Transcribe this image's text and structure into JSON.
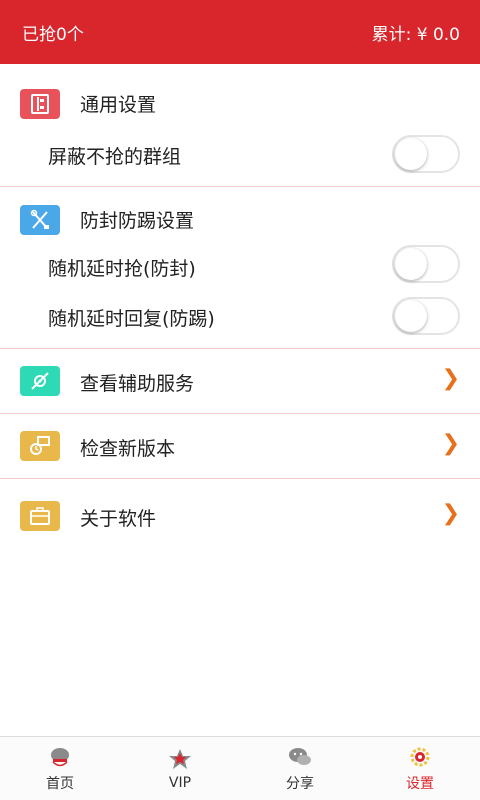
{
  "header": {
    "grabbed": "已抢0个",
    "total": "累计: ¥ 0.0"
  },
  "sections": {
    "general": {
      "title": "通用设置",
      "icon": "sliders-icon",
      "color": "#e8525a"
    },
    "block_groups": {
      "label": "屏蔽不抢的群组",
      "on": false
    },
    "anti": {
      "title": "防封防踢设置",
      "icon": "tools-icon",
      "color": "#4aa8e8"
    },
    "random_delay_grab": {
      "label": "随机延时抢(防封)",
      "on": false
    },
    "random_delay_reply": {
      "label": "随机延时回复(防踢)",
      "on": false
    },
    "accessibility": {
      "title": "查看辅助服务",
      "icon": "service-icon",
      "color": "#2ed9b5"
    },
    "update": {
      "title": "检查新版本",
      "icon": "update-icon",
      "color": "#e8b84a"
    },
    "about": {
      "title": "关于软件",
      "icon": "briefcase-icon",
      "color": "#e8b84a"
    }
  },
  "tabs": [
    {
      "label": "首页",
      "icon": "home-icon",
      "active": false
    },
    {
      "label": "VIP",
      "icon": "vip-icon",
      "active": false
    },
    {
      "label": "分享",
      "icon": "share-icon",
      "active": false
    },
    {
      "label": "设置",
      "icon": "settings-icon",
      "active": true
    }
  ],
  "colors": {
    "accent": "#d9262c",
    "chevron": "#e8701a"
  }
}
